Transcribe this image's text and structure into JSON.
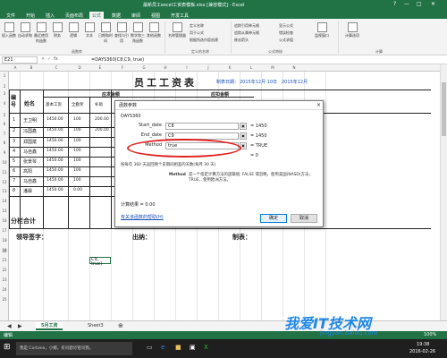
{
  "window": {
    "title": "最新员工excel工资表模板.xlsx [兼容模式] - Excel",
    "controls": [
      "?",
      "—",
      "□",
      "✕"
    ]
  },
  "tabs": [
    "文件",
    "开始",
    "插入",
    "页面布局",
    "公式",
    "数据",
    "审阅",
    "视图",
    "开发工具"
  ],
  "active_tab": "公式",
  "ribbon": {
    "buttons": [
      "插入函数",
      "自动求和",
      "最近使用的函数",
      "财务",
      "逻辑",
      "文本",
      "日期和时间",
      "查找与引用",
      "数学和三角函数",
      "其他函数"
    ],
    "group_function_library": "函数库",
    "name_manager": "名称管理器",
    "define_name": "定义名称",
    "use_in_formula": "用于公式",
    "create_from_selection": "根据所选内容创建",
    "group_defined_names": "定义的名称",
    "trace_precedents": "追踪引用单元格",
    "trace_dependents": "追踪从属单元格",
    "remove_arrows": "移去箭头",
    "show_formulas": "显示公式",
    "error_checking": "错误检查",
    "evaluate_formula": "公式求值",
    "watch_window": "监视窗口",
    "group_formula_auditing": "公式审核",
    "calc_options": "计算选项",
    "group_calculation": "计算"
  },
  "formula_bar": {
    "name_box": "E21",
    "fx": "fx",
    "formula": "=DAYS360(C8,C9, true)"
  },
  "columns": [
    "A",
    "B",
    "C",
    "D",
    "E",
    "F",
    "G",
    "H",
    "I",
    "J",
    "K",
    "L",
    "M",
    "N"
  ],
  "rows": [
    "1",
    "2",
    "3",
    "4",
    "5",
    "6",
    "7",
    "8",
    "9",
    "10",
    "11",
    "12",
    "13",
    "14",
    "15",
    "16",
    "17",
    "18",
    "19",
    "20",
    "21",
    "22",
    "23",
    "24",
    "25"
  ],
  "sheet": {
    "title": "员工工资表",
    "date_label": "制表日期：",
    "date_value": "2015年12月 10日",
    "date_value2": "2015年12月",
    "header_seq": "编号",
    "header_name": "姓名",
    "header_due": "应发金额",
    "header_deduct": "应扣金额",
    "sub_base": "基本工资",
    "sub_allowance": "全勤奖",
    "sub_bonus": "补助",
    "employees": [
      {
        "no": "1",
        "name": "王卫明",
        "base": "1450.00",
        "allow": "100",
        "bonus": "200.00"
      },
      {
        "no": "2",
        "name": "冯国鑫",
        "base": "1450.00",
        "allow": "100",
        "bonus": "200.00"
      },
      {
        "no": "3",
        "name": "郑国斌",
        "base": "1450.00",
        "allow": "100",
        "bonus": ""
      },
      {
        "no": "4",
        "name": "马自鑫",
        "base": "1450.00",
        "allow": "100",
        "bonus": ""
      },
      {
        "no": "5",
        "name": "张景琴",
        "base": "1450.00",
        "allow": "100",
        "bonus": ""
      },
      {
        "no": "6",
        "name": "高阳",
        "base": "1450.00",
        "allow": "100",
        "bonus": ""
      },
      {
        "no": "7",
        "name": "马自鑫",
        "base": "1450.00",
        "allow": "100",
        "bonus": ""
      },
      {
        "no": "8",
        "name": "潘霖",
        "base": "1450.00",
        "allow": "0.00",
        "bonus": ""
      }
    ],
    "subtotal": "分栏合计",
    "sign_leader": "领导签字：",
    "sign_cashier": "出纳：",
    "sign_maker": "制表：",
    "selected_cell_text": "C9, true)"
  },
  "dialog": {
    "title": "函数参数",
    "func_name": "DAYS360",
    "args": [
      {
        "label": "Start_date",
        "value": "C8",
        "result": "= 1450"
      },
      {
        "label": "End_date",
        "value": "C9",
        "result": "= 1450"
      },
      {
        "label": "Method",
        "value": "true",
        "result": "= TRUE"
      }
    ],
    "equals_zero": "= 0",
    "description": "按每年 360 天返回两个日期间相差的天数(每月 30 天)",
    "arg_help_label": "Method",
    "arg_help_text": "是一个指定计算方法的逻辑值: FALSE 或忽略，使用美国(NASD)方法；TRUE，使用欧洲方法。",
    "calc_result_label": "计算结果 = ",
    "calc_result_value": "0.00",
    "help_link": "有关该函数的帮助(H)",
    "ok": "确定",
    "cancel": "取消"
  },
  "sheet_tabs": [
    "5月工资",
    "Sheet3"
  ],
  "active_sheet": "5月工资",
  "status": {
    "mode": "编辑",
    "zoom": "100%"
  },
  "taskbar": {
    "search": "我是 Cortana，小娜。有问题尽管问我。",
    "time": "19:38",
    "date": "2016-02-26"
  },
  "watermark": {
    "line1": "我爱IT技术网",
    "line2": "jingyan.baidu.com"
  },
  "colors": {
    "excel_green": "#217346",
    "highlight_red": "#e02020"
  }
}
